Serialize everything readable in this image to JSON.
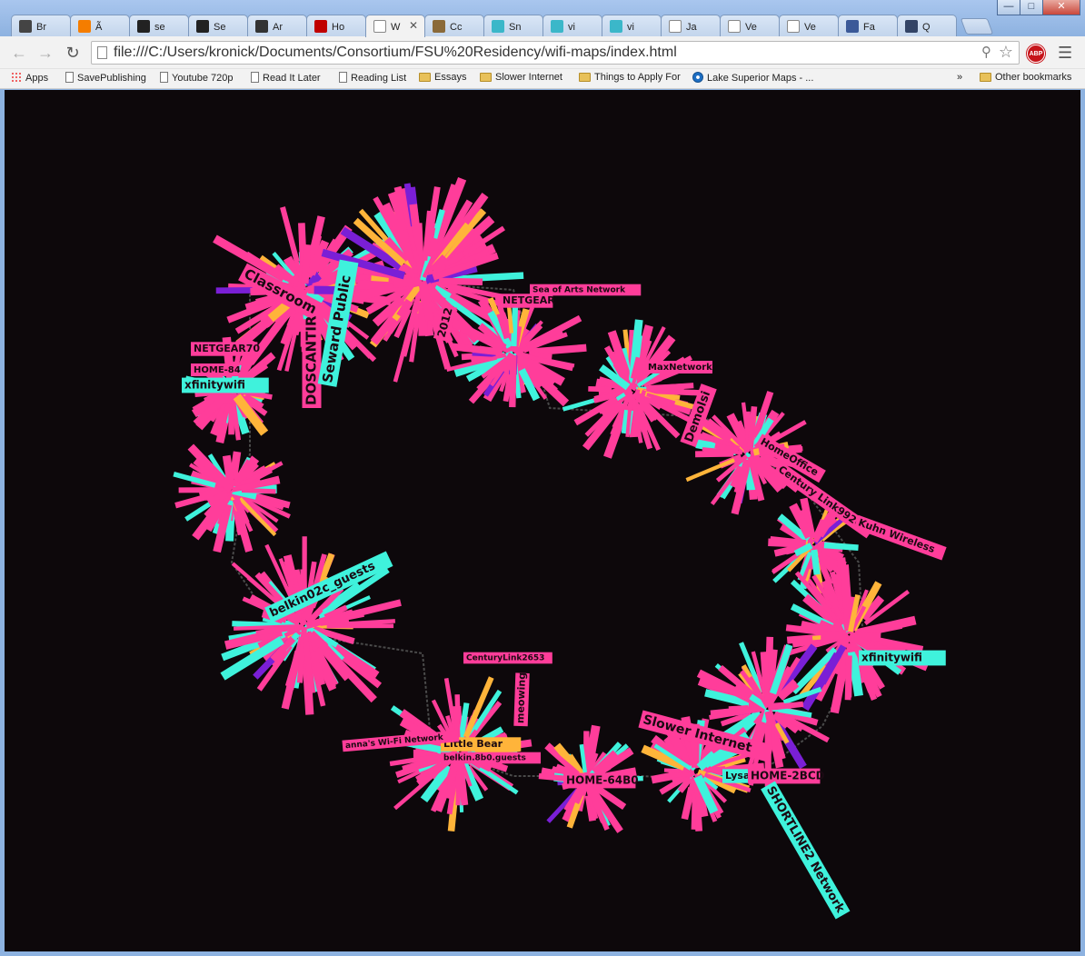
{
  "tabs": [
    {
      "label": "Br",
      "icon": "artdrug-icon",
      "color": "#444444"
    },
    {
      "label": "Ã",
      "icon": "blogger-icon",
      "color": "#f57d00"
    },
    {
      "label": "se",
      "icon": "squarespace-icon",
      "color": "#222222"
    },
    {
      "label": "Se",
      "icon": "squarespace-icon",
      "color": "#222222"
    },
    {
      "label": "Ar",
      "icon": "lrb-icon",
      "color": "#333333"
    },
    {
      "label": "Ho",
      "icon": "netflix-n-icon",
      "color": "#c00000"
    },
    {
      "label": "W",
      "icon": "page-icon",
      "color": "#ffffff",
      "active": true
    },
    {
      "label": "Cc",
      "icon": "palette-icon",
      "color": "#8a6a3a"
    },
    {
      "label": "Sn",
      "icon": "circle-icon",
      "color": "#3bb7c9"
    },
    {
      "label": "vi",
      "icon": "circle-icon",
      "color": "#3bb7c9"
    },
    {
      "label": "vi",
      "icon": "circle-icon",
      "color": "#3bb7c9"
    },
    {
      "label": "Ja",
      "icon": "page-icon",
      "color": "#ffffff"
    },
    {
      "label": "Ve",
      "icon": "page-icon",
      "color": "#ffffff"
    },
    {
      "label": "Ve",
      "icon": "page-icon",
      "color": "#ffffff"
    },
    {
      "label": "Fa",
      "icon": "facebook-icon",
      "color": "#3b5998"
    },
    {
      "label": "Q",
      "icon": "wave-icon",
      "color": "#334466"
    }
  ],
  "toolbar": {
    "url": "file:///C:/Users/kronick/Documents/Consortium/FSU%20Residency/wifi-maps/index.html",
    "abp_label": "ABP"
  },
  "bookmarks": [
    {
      "label": "Apps",
      "icon": "apps"
    },
    {
      "label": "SavePublishing",
      "icon": "doc"
    },
    {
      "label": "Youtube 720p",
      "icon": "doc"
    },
    {
      "label": "Read It Later",
      "icon": "doc"
    },
    {
      "label": "Reading List",
      "icon": "doc"
    },
    {
      "label": "Essays",
      "icon": "folder"
    },
    {
      "label": "Slower Internet",
      "icon": "folder"
    },
    {
      "label": "Things to Apply For",
      "icon": "folder"
    },
    {
      "label": "Lake Superior Maps - ...",
      "icon": "noaa"
    }
  ],
  "bookmarks_overflow": "»",
  "other_bookmarks": "Other bookmarks",
  "colors": {
    "pink": "#ff3d9a",
    "cyan": "#3ff2dc",
    "orange": "#ffb43a",
    "purple": "#7a1fd6",
    "background": "#0d080b"
  },
  "map_labels": [
    {
      "text": "Classroom",
      "color": "pink"
    },
    {
      "text": "DOSCANTIR",
      "color": "pink"
    },
    {
      "text": "Seward Public",
      "color": "cyan"
    },
    {
      "text": "NETGEAR70",
      "color": "pink"
    },
    {
      "text": "xfinitywifi",
      "color": "cyan"
    },
    {
      "text": "HOME-84",
      "color": "pink"
    },
    {
      "text": "NETGEAR",
      "color": "pink"
    },
    {
      "text": "2012",
      "color": "pink"
    },
    {
      "text": "MaxNetwork",
      "color": "pink"
    },
    {
      "text": "Demolsi",
      "color": "pink"
    },
    {
      "text": "HomeOffice",
      "color": "pink"
    },
    {
      "text": "Century Link9926",
      "color": "pink"
    },
    {
      "text": "Kuhn Wireless",
      "color": "pink"
    },
    {
      "text": "xfinitywifi",
      "color": "cyan"
    },
    {
      "text": "belkin02c_guests",
      "color": "cyan"
    },
    {
      "text": "Slower Internet",
      "color": "pink"
    },
    {
      "text": "HOME-64B0",
      "color": "pink"
    },
    {
      "text": "Lysak",
      "color": "cyan"
    },
    {
      "text": "HOME-2BCD",
      "color": "pink"
    },
    {
      "text": "SHORTLINE2 Network",
      "color": "cyan"
    },
    {
      "text": "Little Bear",
      "color": "orange"
    },
    {
      "text": "belkin.8b0.guests",
      "color": "pink"
    },
    {
      "text": "CenturyLink2653",
      "color": "pink"
    },
    {
      "text": "anna's Wi-Fi Network",
      "color": "pink"
    },
    {
      "text": "meowing",
      "color": "pink"
    },
    {
      "text": "Sea of Arts Network",
      "color": "pink"
    }
  ]
}
